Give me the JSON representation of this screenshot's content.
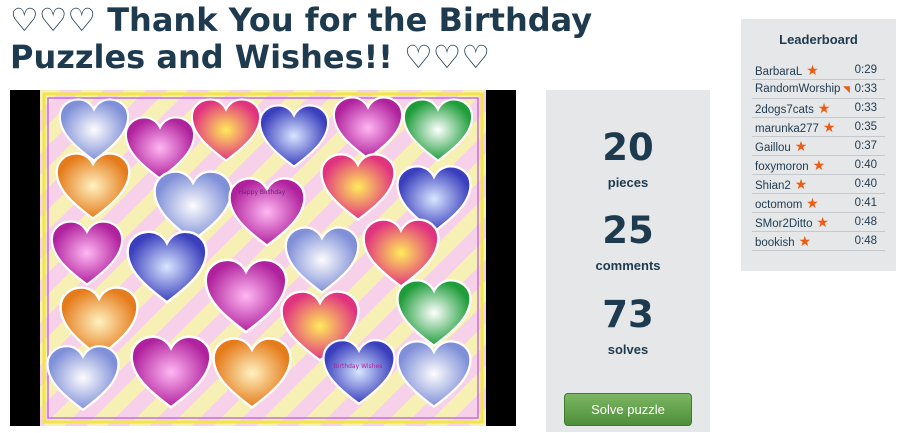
{
  "title": "♡♡♡ Thank You for the Birthday Puzzles and Wishes!! ♡♡♡",
  "stats": {
    "pieces_value": "20",
    "pieces_label": "pieces",
    "comments_value": "25",
    "comments_label": "comments",
    "solves_value": "73",
    "solves_label": "solves",
    "solve_button": "Solve puzzle"
  },
  "leaderboard": {
    "title": "Leaderboard",
    "rows": [
      {
        "name": "BarbaraL",
        "time": "0:29",
        "badge": "star-icon"
      },
      {
        "name": "RandomWorship",
        "time": "0:33",
        "badge": "flag-icon"
      },
      {
        "name": "2dogs7cats",
        "time": "0:33",
        "badge": "star-icon"
      },
      {
        "name": "marunka277",
        "time": "0:35",
        "badge": "star-icon"
      },
      {
        "name": "Gaillou",
        "time": "0:37",
        "badge": "star-icon"
      },
      {
        "name": "foxymoron",
        "time": "0:40",
        "badge": "star-icon"
      },
      {
        "name": "Shian2",
        "time": "0:40",
        "badge": "star-icon"
      },
      {
        "name": "octomom",
        "time": "0:41",
        "badge": "star-icon"
      },
      {
        "name": "SMor2Ditto",
        "time": "0:48",
        "badge": "star-icon"
      },
      {
        "name": "bookish",
        "time": "0:48",
        "badge": "star-icon"
      }
    ]
  },
  "puzzle_image": {
    "heart_labels": {
      "happy_birthday": "Happy Birthday",
      "birthday_wishes": "Birthday Wishes"
    }
  },
  "colors": {
    "heading": "#1e3a4f",
    "panel": "#e5e7e8",
    "accent_star": "#ef5b12",
    "button": "#5e9e47"
  }
}
